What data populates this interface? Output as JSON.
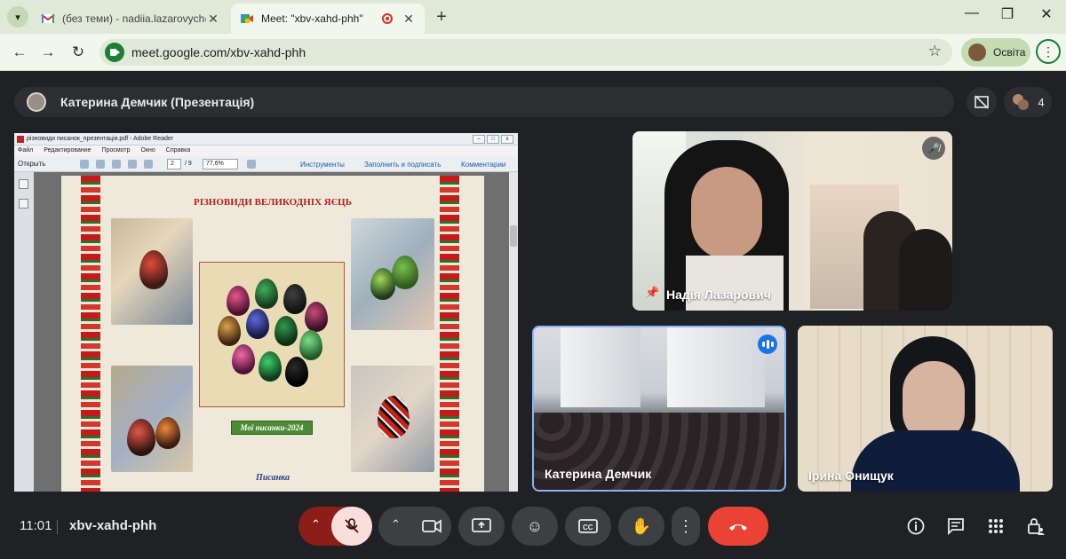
{
  "browser": {
    "tabs": [
      {
        "title": "(без теми) - nadiia.lazarovych@",
        "active": false,
        "icon": "gmail-icon"
      },
      {
        "title": "Meet: \"xbv-xahd-phh\"",
        "active": true,
        "icon": "meet-icon",
        "recording": true
      }
    ],
    "new_tab_label": "+",
    "url": "meet.google.com/xbv-xahd-phh",
    "profile_label": "Освіта",
    "window_controls": {
      "minimize": "—",
      "maximize": "❐",
      "close": "✕"
    }
  },
  "meet": {
    "presenter_label": "Катерина Демчик (Презентація)",
    "participant_count": "4",
    "time": "11:01",
    "meeting_code": "xbv-xahd-phh",
    "participants": [
      {
        "name": "Надія Лазарович",
        "muted": true,
        "pinned": true
      },
      {
        "name": "Катерина Демчик",
        "speaking": true
      },
      {
        "name": "Ірина Онищук"
      }
    ]
  },
  "shared_screen": {
    "window_title": "різновиди писанок_презентація.pdf - Adobe Reader",
    "menu": [
      "Файл",
      "Редактирование",
      "Просмотр",
      "Окно",
      "Справка"
    ],
    "toolbar": {
      "open_label": "Открыть",
      "page_current": "2",
      "page_total": "/ 9",
      "zoom": "77,6%",
      "links": [
        "Инструменты",
        "Заполнить и подписать",
        "Комментарии"
      ]
    },
    "slide": {
      "title": "РІЗНОВИДИ ВЕЛИКОДНІХ ЯЄЦЬ",
      "caption": "Мої писанки-2024",
      "subtitle": "Писанка"
    }
  },
  "colors": {
    "meet_bg": "#202124",
    "control_bg": "#3c4043",
    "end_call": "#ea4335",
    "accent_blue": "#1a73e8",
    "chrome_tab_bg": "#dfe9d8"
  }
}
